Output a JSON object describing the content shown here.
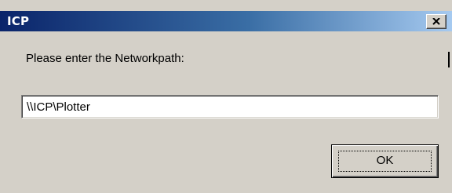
{
  "dialog": {
    "title": "ICP",
    "close_icon": "close-x-icon",
    "prompt": "Please enter the Networkpath:",
    "path_value": "\\\\ICP\\Plotter",
    "ok_label": "OK"
  },
  "colors": {
    "titlebar_start": "#0a246a",
    "titlebar_end": "#a6caf0",
    "face": "#d4d0c8"
  }
}
